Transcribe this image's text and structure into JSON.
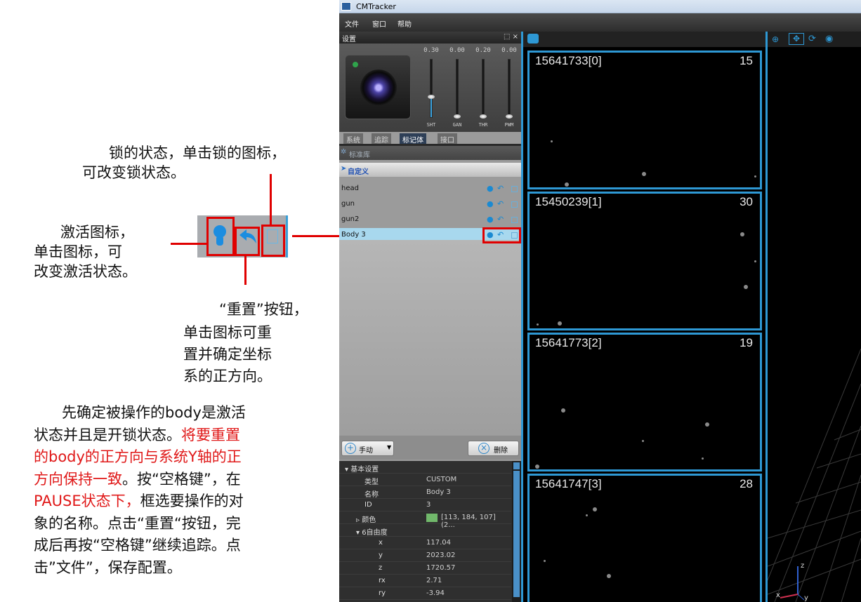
{
  "app": {
    "title": "CMTracker",
    "menu": [
      "文件",
      "窗口",
      "帮助"
    ],
    "settings_title": "设置",
    "panel_controls": "⬚ ×"
  },
  "sliders": [
    {
      "value": "0.30",
      "label": "SHT",
      "fill": 0.36
    },
    {
      "value": "0.00",
      "label": "GAN",
      "fill": 0.0
    },
    {
      "value": "0.20",
      "label": "THR",
      "fill": 0.0
    },
    {
      "value": "0.00",
      "label": "PWM",
      "fill": 0.0
    }
  ],
  "tabs": [
    "系统",
    "追踪",
    "标记体",
    "接口"
  ],
  "active_tab": "标记体",
  "library_header": "标准库",
  "custom_header": "自定义",
  "bodies": [
    "head",
    "gun",
    "gun2",
    "Body 3"
  ],
  "selected_body": "Body 3",
  "buttons": {
    "manual": "手动",
    "delete": "删除"
  },
  "properties": {
    "group_basic": "基本设置",
    "type_key": "类型",
    "type_val": "CUSTOM",
    "name_key": "名称",
    "name_val": "Body 3",
    "id_key": "ID",
    "id_val": "3",
    "color_key": "颜色",
    "color_val": "[113, 184, 107] (2...",
    "color_hex": "#71b86b",
    "group_dof": "6自由度",
    "x_key": "x",
    "x_val": "117.04",
    "y_key": "y",
    "y_val": "2023.02",
    "z_key": "z",
    "z_val": "1720.57",
    "rx_key": "rx",
    "rx_val": "2.71",
    "ry_key": "ry",
    "ry_val": "-3.94"
  },
  "views": [
    {
      "id": "15641733[0]",
      "count": "15"
    },
    {
      "id": "15450239[1]",
      "count": "30"
    },
    {
      "id": "15641773[2]",
      "count": "19"
    },
    {
      "id": "15641747[3]",
      "count": "28"
    }
  ],
  "axes": {
    "z": "z",
    "x": "x",
    "y": "y"
  },
  "annotations": {
    "lock_1": "锁的状态，单击锁的图标，",
    "lock_2": "可改变锁状态。",
    "act_1": "激活图标，",
    "act_2": "单击图标，可",
    "act_3": "改变激活状态。",
    "reset_1": "“重置”按钮，",
    "reset_2": "单击图标可重",
    "reset_3": "置并确定坐标",
    "reset_4": "系的正方向。",
    "p1": "先确定被操作的body是激活",
    "p2a": "状态并且是开锁状态。",
    "p2b": "将要重置",
    "p3": "的body的正方向与系统Y轴的正",
    "p4a": "方向保持一致",
    "p4b": "。按“空格键”，在",
    "p5a": "PAUSE状态下，",
    "p5b": "框选要操作的对",
    "p6": "象的名称。点击“重置“按钮，完",
    "p7": "成后再按“空格键”继续追踪。点",
    "p8": "击”文件”，保存配置。"
  },
  "colors": {
    "accent": "#2e98d4",
    "annotation_red": "#e00000"
  }
}
